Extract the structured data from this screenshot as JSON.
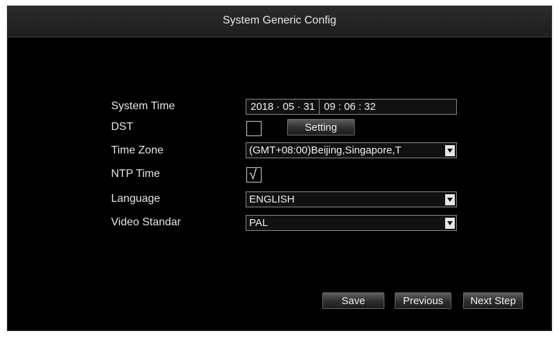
{
  "window": {
    "title": "System Generic Config"
  },
  "form": {
    "system_time": {
      "label": "System Time",
      "date": "2018 · 05 · 31",
      "time": "09 : 06 : 32"
    },
    "dst": {
      "label": "DST",
      "checked": false,
      "setting_button": "Setting"
    },
    "time_zone": {
      "label": "Time Zone",
      "value": "(GMT+08:00)Beijing,Singapore,T"
    },
    "ntp_time": {
      "label": "NTP Time",
      "checked": true,
      "checkmark": "√"
    },
    "language": {
      "label": "Language",
      "value": "ENGLISH"
    },
    "video_standard": {
      "label": "Video Standar",
      "value": "PAL"
    }
  },
  "buttons": {
    "save": "Save",
    "previous": "Previous",
    "next": "Next Step"
  },
  "icons": {
    "dropdown": "chevron-down-icon",
    "check": "check-icon"
  }
}
